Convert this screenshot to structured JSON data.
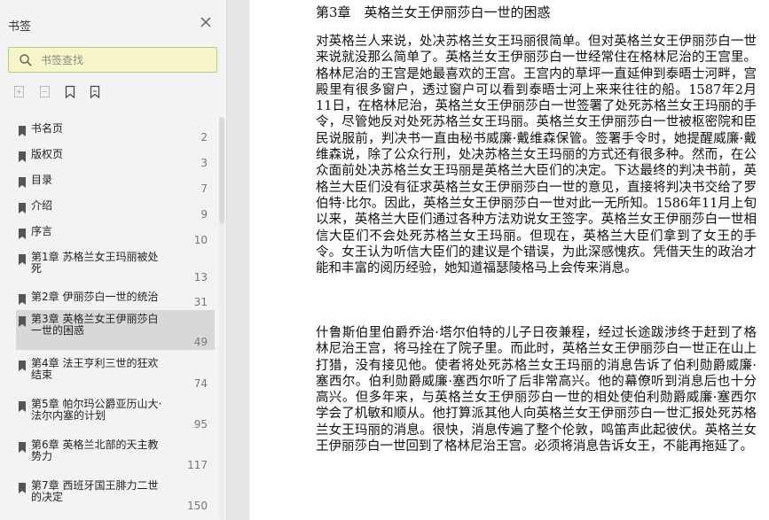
{
  "sidebar": {
    "title": "书签",
    "search_placeholder": "书签查找",
    "items": [
      {
        "label": "书名页",
        "page": "2"
      },
      {
        "label": "版权页",
        "page": "3"
      },
      {
        "label": "目录",
        "page": "7"
      },
      {
        "label": "介绍",
        "page": "9"
      },
      {
        "label": "序言",
        "page": "10"
      },
      {
        "label": "第1章 苏格兰女王玛丽被处死",
        "page": "13"
      },
      {
        "label": "第2章 伊丽莎白一世的统治",
        "page": "31"
      },
      {
        "label": "第3章 英格兰女王伊丽莎白一世的困惑",
        "page": "49"
      },
      {
        "label": "第4章 法王亨利三世的狂欢结束",
        "page": "74"
      },
      {
        "label": "第5章 帕尔玛公爵亚历山大·法尔内塞的计划",
        "page": "95"
      },
      {
        "label": "第6章 英格兰北部的天主教势力",
        "page": "117"
      },
      {
        "label": "第7章 西班牙国王腓力二世的决定",
        "page": "150"
      }
    ],
    "selected_index": 7
  },
  "document": {
    "chapter_title": "第3章　英格兰女王伊丽莎白一世的困惑",
    "paragraphs": [
      "对英格兰人来说，处决苏格兰女王玛丽很简单。但对英格兰女王伊丽莎白一世来说就没那么简单了。英格兰女王伊丽莎白一世经常住在格林尼治的王宫里。格林尼治的王宫是她最喜欢的王宫。王宫内的草坪一直延伸到泰晤士河畔，宫殿里有很多窗户，透过窗户可以看到泰晤士河上来来往往的船。1587年2月11日，在格林尼治，英格兰女王伊丽莎白一世签署了处死苏格兰女王玛丽的手令，尽管她反对处死苏格兰女王玛丽。英格兰女王伊丽莎白一世被枢密院和臣民说服前，判决书一直由秘书威廉·戴维森保管。签署手令时，她提醒威廉·戴维森说，除了公众行刑，处决苏格兰女王玛丽的方式还有很多种。然而，在公众面前处决苏格兰女王玛丽是英格兰大臣们的决定。下达最终的判决书前，英格兰大臣们没有征求英格兰女王伊丽莎白一世的意见，直接将判决书交给了罗伯特·比尔。因此，英格兰女王伊丽莎白一世对此一无所知。1586年11月上旬以来，英格兰大臣们通过各种方法劝说女王签字。英格兰女王伊丽莎白一世相信大臣们不会处死苏格兰女王玛丽。但现在，英格兰大臣们拿到了女王的手令。女王认为听信大臣们的建议是个错误，为此深感愧疚。凭借天生的政治才能和丰富的阅历经验，她知道福瑟陵格马上会传来消息。",
      "什鲁斯伯里伯爵乔治·塔尔伯特的儿子日夜兼程，经过长途跋涉终于赶到了格林尼治王宫，将马拴在了院子里。而此时，英格兰女王伊丽莎白一世正在山上打猎，没有接见他。使者将处死苏格兰女王玛丽的消息告诉了伯利勋爵威廉·塞西尔。伯利勋爵威廉·塞西尔听了后非常高兴。他的幕僚听到消息后也十分高兴。但多年来，与英格兰女王伊丽莎白一世的相处使伯利勋爵威廉·塞西尔学会了机敏和顺从。他打算派其他人向英格兰女王伊丽莎白一世汇报处死苏格兰女王玛丽的消息。很快，消息传遍了整个伦敦，鸣笛声此起彼伏。英格兰女王伊丽莎白一世回到了格林尼治王宫。必须将消息告诉女王，不能再拖延了。"
    ]
  },
  "colors": {
    "sidebar_bg": "#f3f3f3",
    "search_bg": "#f6f6c8",
    "search_border": "#b9c88b",
    "selected_bg": "#d8d8d8",
    "page_bg": "#ffffff",
    "desk_bg": "#e6e6e6"
  },
  "icons": [
    "close-icon",
    "search-icon",
    "add-bookmark-icon",
    "remove-bookmark-icon",
    "expand-bookmark-icon",
    "collapse-bookmark-icon",
    "bookmark-icon"
  ]
}
